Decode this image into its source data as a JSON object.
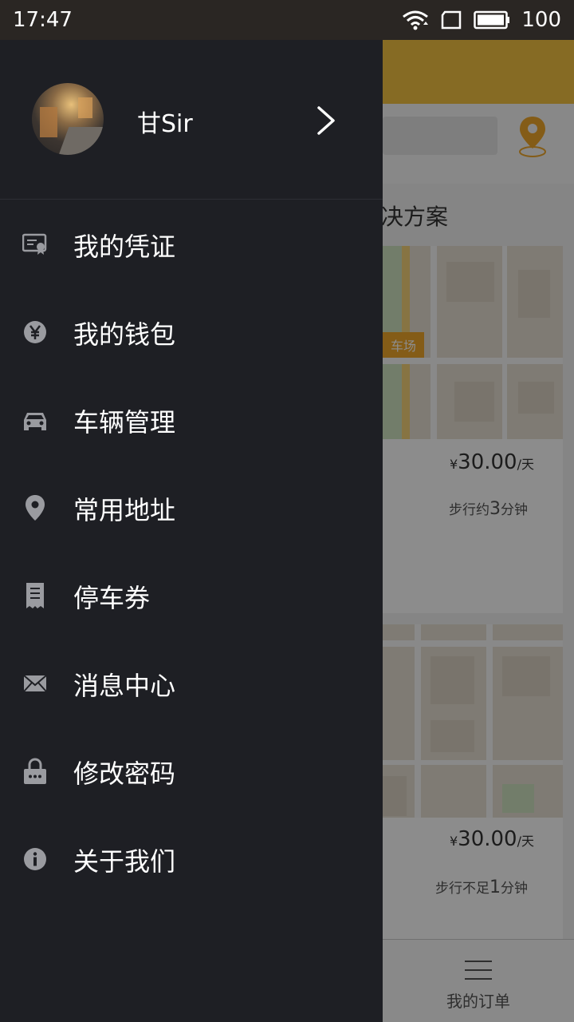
{
  "status_bar": {
    "time": "17:47",
    "battery": "100"
  },
  "drawer": {
    "user": {
      "name": "甘Sir"
    },
    "menu": [
      {
        "id": "credentials",
        "label": "我的凭证",
        "icon": "certificate-icon"
      },
      {
        "id": "wallet",
        "label": "我的钱包",
        "icon": "yuan-coin-icon"
      },
      {
        "id": "vehicles",
        "label": "车辆管理",
        "icon": "car-icon"
      },
      {
        "id": "addresses",
        "label": "常用地址",
        "icon": "location-pin-icon"
      },
      {
        "id": "coupons",
        "label": "停车券",
        "icon": "receipt-icon"
      },
      {
        "id": "messages",
        "label": "消息中心",
        "icon": "mail-icon"
      },
      {
        "id": "password",
        "label": "修改密码",
        "icon": "lock-icon"
      },
      {
        "id": "about",
        "label": "关于我们",
        "icon": "info-icon"
      }
    ]
  },
  "background": {
    "section_title": "决方案",
    "map_tag": "车场",
    "cards": [
      {
        "currency": "¥",
        "price": "30.00",
        "unit": "/天",
        "walk_prefix": "步行约",
        "walk_value": "3",
        "walk_suffix": "分钟"
      },
      {
        "currency": "¥",
        "price": "30.00",
        "unit": "/天",
        "walk_prefix": "步行不足",
        "walk_value": "1",
        "walk_suffix": "分钟"
      }
    ],
    "tabbar": {
      "orders_label": "我的订单"
    }
  },
  "colors": {
    "drawer_bg": "#1e1f24",
    "header_accent": "#f4c343",
    "icon_gray": "#9a9ba0"
  }
}
